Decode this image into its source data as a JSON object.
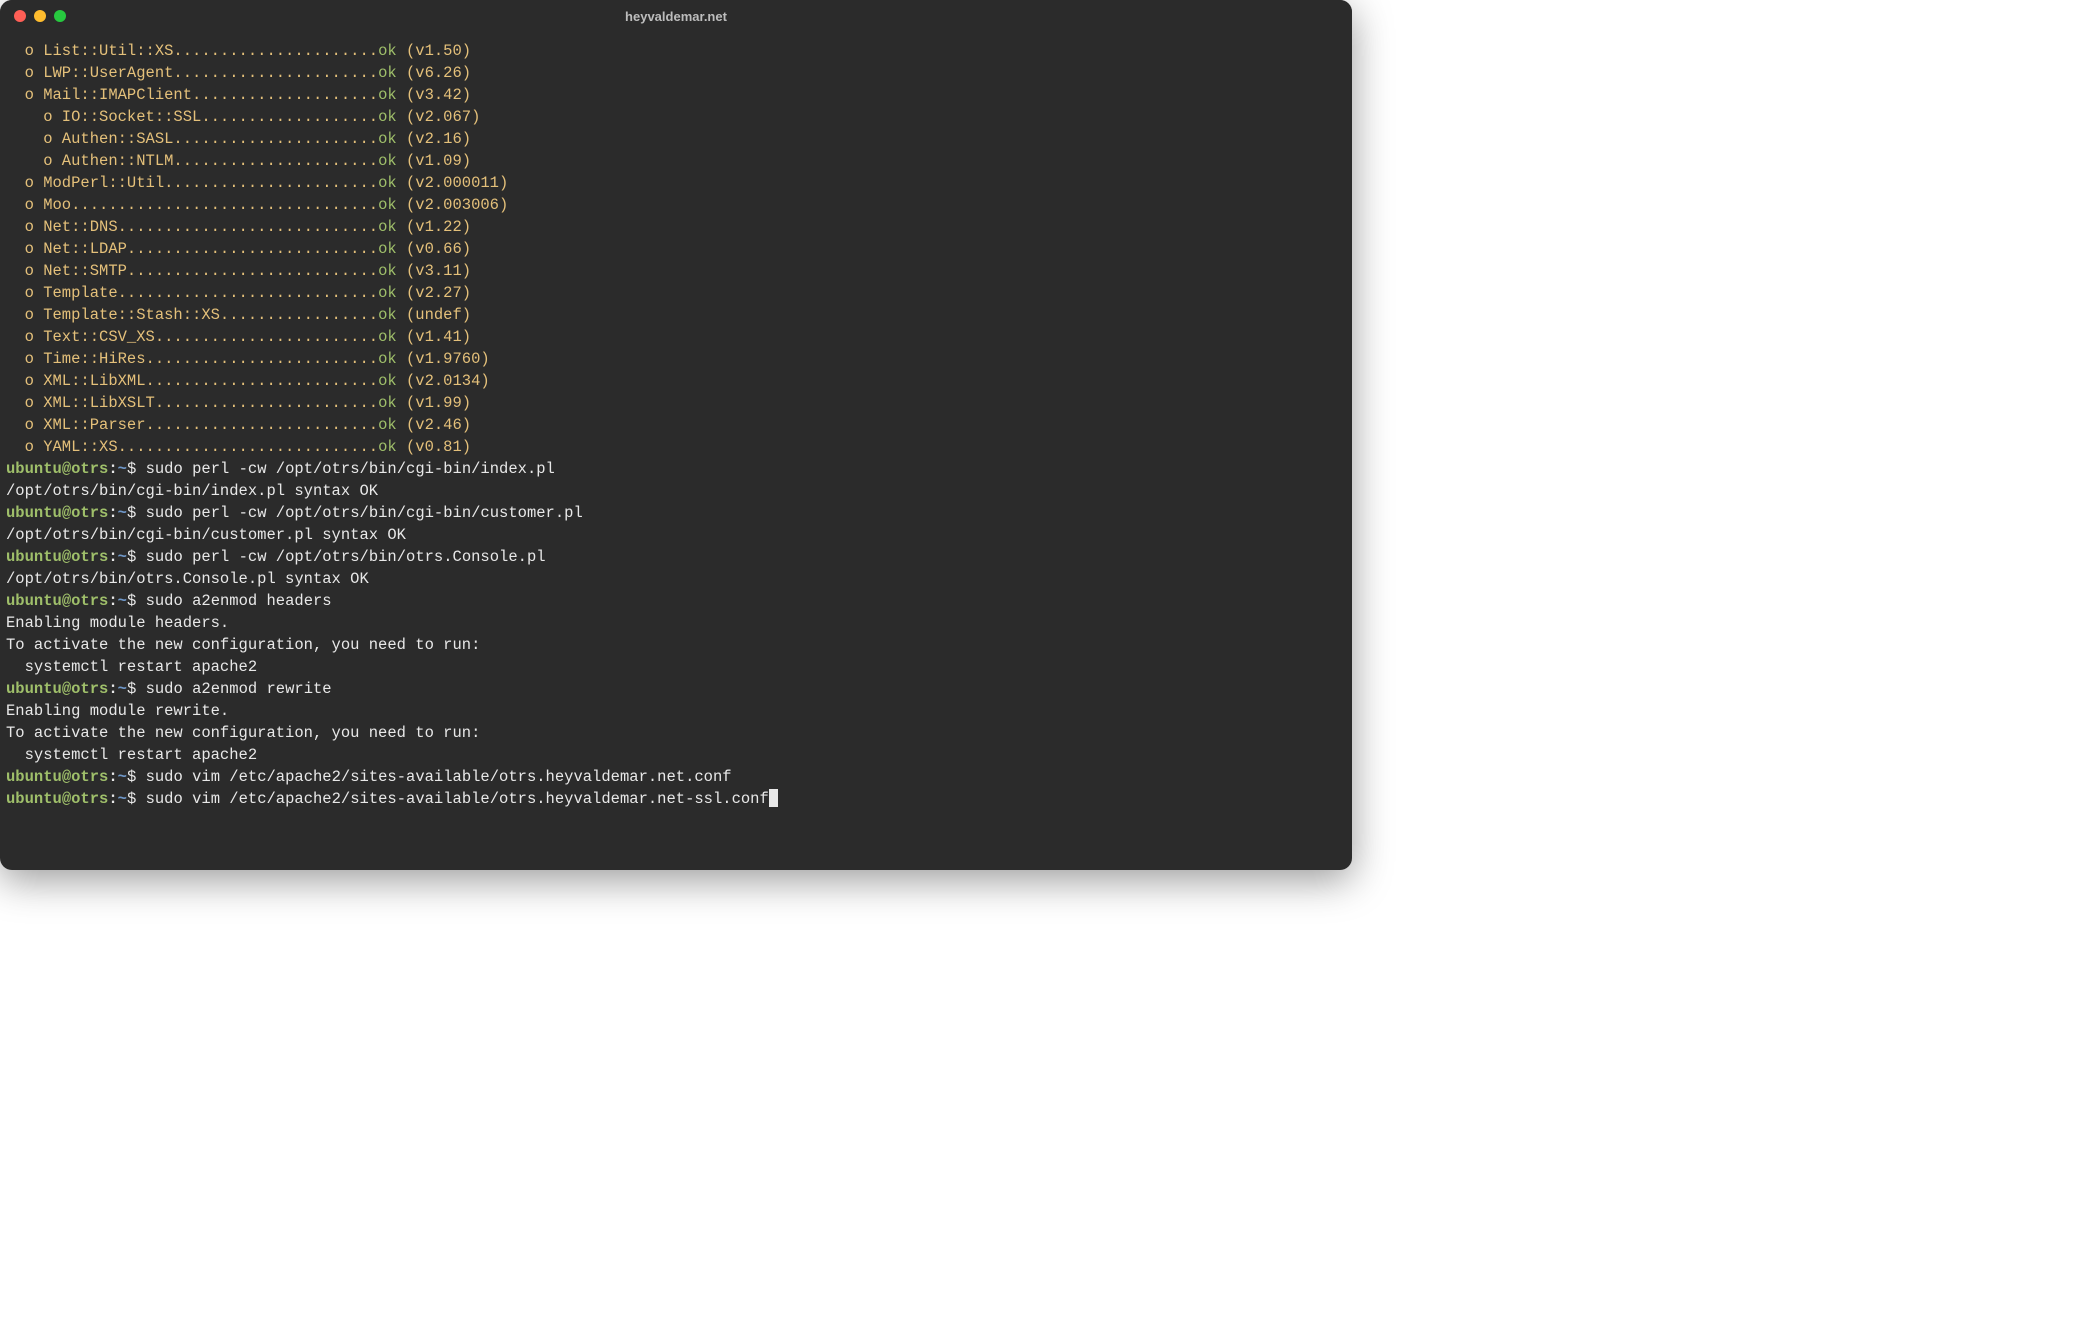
{
  "window": {
    "title": "heyvaldemar.net"
  },
  "modules": [
    {
      "indent": 1,
      "name": "List::Util::XS",
      "ver": "v1.50"
    },
    {
      "indent": 1,
      "name": "LWP::UserAgent",
      "ver": "v6.26"
    },
    {
      "indent": 1,
      "name": "Mail::IMAPClient",
      "ver": "v3.42"
    },
    {
      "indent": 2,
      "name": "IO::Socket::SSL",
      "ver": "v2.067"
    },
    {
      "indent": 2,
      "name": "Authen::SASL",
      "ver": "v2.16"
    },
    {
      "indent": 2,
      "name": "Authen::NTLM",
      "ver": "v1.09"
    },
    {
      "indent": 1,
      "name": "ModPerl::Util",
      "ver": "v2.000011"
    },
    {
      "indent": 1,
      "name": "Moo",
      "ver": "v2.003006"
    },
    {
      "indent": 1,
      "name": "Net::DNS",
      "ver": "v1.22"
    },
    {
      "indent": 1,
      "name": "Net::LDAP",
      "ver": "v0.66"
    },
    {
      "indent": 1,
      "name": "Net::SMTP",
      "ver": "v3.11"
    },
    {
      "indent": 1,
      "name": "Template",
      "ver": "v2.27"
    },
    {
      "indent": 1,
      "name": "Template::Stash::XS",
      "ver": "undef"
    },
    {
      "indent": 1,
      "name": "Text::CSV_XS",
      "ver": "v1.41"
    },
    {
      "indent": 1,
      "name": "Time::HiRes",
      "ver": "v1.9760"
    },
    {
      "indent": 1,
      "name": "XML::LibXML",
      "ver": "v2.0134"
    },
    {
      "indent": 1,
      "name": "XML::LibXSLT",
      "ver": "v1.99"
    },
    {
      "indent": 1,
      "name": "XML::Parser",
      "ver": "v2.46"
    },
    {
      "indent": 1,
      "name": "YAML::XS",
      "ver": "v0.81"
    }
  ],
  "module_ok": "ok",
  "module_dotwidth": 40,
  "prompt": {
    "user": "ubuntu",
    "host": "otrs",
    "path": "~",
    "sym": "$"
  },
  "entries": [
    {
      "type": "cmd",
      "text": "sudo perl -cw /opt/otrs/bin/cgi-bin/index.pl"
    },
    {
      "type": "out",
      "text": "/opt/otrs/bin/cgi-bin/index.pl syntax OK"
    },
    {
      "type": "cmd",
      "text": "sudo perl -cw /opt/otrs/bin/cgi-bin/customer.pl"
    },
    {
      "type": "out",
      "text": "/opt/otrs/bin/cgi-bin/customer.pl syntax OK"
    },
    {
      "type": "cmd",
      "text": "sudo perl -cw /opt/otrs/bin/otrs.Console.pl"
    },
    {
      "type": "out",
      "text": "/opt/otrs/bin/otrs.Console.pl syntax OK"
    },
    {
      "type": "cmd",
      "text": "sudo a2enmod headers"
    },
    {
      "type": "out",
      "text": "Enabling module headers."
    },
    {
      "type": "out",
      "text": "To activate the new configuration, you need to run:"
    },
    {
      "type": "out",
      "text": "  systemctl restart apache2"
    },
    {
      "type": "cmd",
      "text": "sudo a2enmod rewrite"
    },
    {
      "type": "out",
      "text": "Enabling module rewrite."
    },
    {
      "type": "out",
      "text": "To activate the new configuration, you need to run:"
    },
    {
      "type": "out",
      "text": "  systemctl restart apache2"
    },
    {
      "type": "cmd",
      "text": "sudo vim /etc/apache2/sites-available/otrs.heyvaldemar.net.conf"
    },
    {
      "type": "cmd",
      "text": "sudo vim /etc/apache2/sites-available/otrs.heyvaldemar.net-ssl.conf",
      "cursor": true
    }
  ]
}
